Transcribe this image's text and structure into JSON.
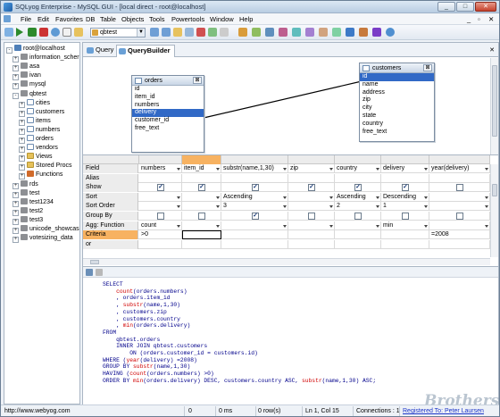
{
  "window": {
    "title": "SQLyog Enterprise - MySQL GUI - [local direct - root@localhost]"
  },
  "menu": [
    "File",
    "Edit",
    "Favorites",
    "DB",
    "Table",
    "Objects",
    "Tools",
    "Powertools",
    "Window",
    "Help"
  ],
  "toolbar": {
    "database": "qbtest"
  },
  "tree": [
    {
      "label": "root@localhost",
      "type": "host",
      "pm": "-"
    },
    {
      "label": "information_scher",
      "type": "db",
      "pm": "+"
    },
    {
      "label": "asa",
      "type": "db",
      "pm": "+"
    },
    {
      "label": "ivan",
      "type": "db",
      "pm": "+"
    },
    {
      "label": "mysql",
      "type": "db",
      "pm": "+"
    },
    {
      "label": "qbtest",
      "type": "db",
      "pm": "-"
    },
    {
      "label": "cities",
      "type": "tbl",
      "pm": "+"
    },
    {
      "label": "customers",
      "type": "tbl",
      "pm": "+"
    },
    {
      "label": "items",
      "type": "tbl",
      "pm": "+"
    },
    {
      "label": "numbers",
      "type": "tbl",
      "pm": "+"
    },
    {
      "label": "orders",
      "type": "tbl",
      "pm": "+"
    },
    {
      "label": "vendors",
      "type": "tbl",
      "pm": "+"
    },
    {
      "label": "Views",
      "type": "fld",
      "pm": "+"
    },
    {
      "label": "Stored Procs",
      "type": "fld",
      "pm": "+"
    },
    {
      "label": "Functions",
      "type": "fn",
      "pm": "+"
    },
    {
      "label": "rds",
      "type": "db",
      "pm": "+"
    },
    {
      "label": "test",
      "type": "db",
      "pm": "+"
    },
    {
      "label": "test1234",
      "type": "db",
      "pm": "+"
    },
    {
      "label": "test2",
      "type": "db",
      "pm": "+"
    },
    {
      "label": "test3",
      "type": "db",
      "pm": "+"
    },
    {
      "label": "unicode_showcase",
      "type": "db",
      "pm": "+"
    },
    {
      "label": "votesizing_data",
      "type": "db",
      "pm": "+"
    }
  ],
  "tabs": [
    {
      "label": "Query",
      "active": false
    },
    {
      "label": "QueryBuilder",
      "active": true
    }
  ],
  "tables": {
    "orders": {
      "title": "orders",
      "fields": [
        "id",
        "item_id",
        "numbers",
        "delivery",
        "customer_id",
        "free_text"
      ],
      "selected": "delivery"
    },
    "customers": {
      "title": "customers",
      "fields": [
        "id",
        "name",
        "address",
        "zip",
        "city",
        "state",
        "country",
        "free_text"
      ],
      "selected": "id"
    }
  },
  "grid": {
    "row_labels": [
      "Field",
      "Alias",
      "Show",
      "Sort",
      "Sort Order",
      "Group By",
      "Agg: Function",
      "Criteria",
      "or"
    ],
    "columns": [
      {
        "field": "numbers",
        "alias": "",
        "show": true,
        "sort": "",
        "sort_order": "",
        "group_by": false,
        "agg": "count",
        "criteria": ">0"
      },
      {
        "field": "item_id",
        "alias": "",
        "show": true,
        "sort": "",
        "sort_order": "",
        "group_by": false,
        "agg": "",
        "criteria": ""
      },
      {
        "field": "substr(name,1,30)",
        "alias": "",
        "show": true,
        "sort": "Ascending",
        "sort_order": "3",
        "group_by": true,
        "agg": "",
        "criteria": ""
      },
      {
        "field": "zip",
        "alias": "",
        "show": true,
        "sort": "",
        "sort_order": "",
        "group_by": false,
        "agg": "",
        "criteria": ""
      },
      {
        "field": "country",
        "alias": "",
        "show": true,
        "sort": "Ascending",
        "sort_order": "2",
        "group_by": false,
        "agg": "",
        "criteria": ""
      },
      {
        "field": "delivery",
        "alias": "",
        "show": true,
        "sort": "Descending",
        "sort_order": "1",
        "group_by": false,
        "agg": "min",
        "criteria": ""
      },
      {
        "field": "year(delivery)",
        "alias": "",
        "show": false,
        "sort": "",
        "sort_order": "",
        "group_by": false,
        "agg": "",
        "criteria": "=2008"
      }
    ]
  },
  "sql": [
    [
      {
        "t": "SELECT"
      }
    ],
    [
      {
        "t": "    "
      },
      {
        "t": "count",
        "fn": true
      },
      {
        "t": "(orders.numbers)"
      }
    ],
    [
      {
        "t": "    , orders.item_id"
      }
    ],
    [
      {
        "t": "    , "
      },
      {
        "t": "substr",
        "fn": true
      },
      {
        "t": "(name,1,30)"
      }
    ],
    [
      {
        "t": "    , customers.zip"
      }
    ],
    [
      {
        "t": "    , customers.country"
      }
    ],
    [
      {
        "t": "    , "
      },
      {
        "t": "min",
        "fn": true
      },
      {
        "t": "(orders.delivery)"
      }
    ],
    [
      {
        "t": "FROM"
      }
    ],
    [
      {
        "t": "    qbtest.orders"
      }
    ],
    [
      {
        "t": "    INNER JOIN qbtest.customers"
      }
    ],
    [
      {
        "t": "        ON (orders.customer_id = customers.id)"
      }
    ],
    [
      {
        "t": "WHERE ("
      },
      {
        "t": "year",
        "fn": true
      },
      {
        "t": "(delivery) =2008)"
      }
    ],
    [
      {
        "t": "GROUP BY "
      },
      {
        "t": "substr",
        "fn": true
      },
      {
        "t": "(name,1,30)"
      }
    ],
    [
      {
        "t": "HAVING ("
      },
      {
        "t": "count",
        "fn": true
      },
      {
        "t": "(orders.numbers) >0)"
      }
    ],
    [
      {
        "t": "ORDER BY "
      },
      {
        "t": "min",
        "fn": true
      },
      {
        "t": "(orders.delivery) DESC, customers.country ASC, "
      },
      {
        "t": "substr",
        "fn": true
      },
      {
        "t": "(name,1,30) ASC;"
      }
    ]
  ],
  "watermark": "Brothersoft",
  "status": {
    "url": "http://www.webyog.com",
    "col2": "0",
    "time": "0 ms",
    "rows": "0 row(s)",
    "pos": "Ln 1, Col 15",
    "connections": "Connections : 1",
    "registered": "Registered To: Peter Laursen"
  }
}
